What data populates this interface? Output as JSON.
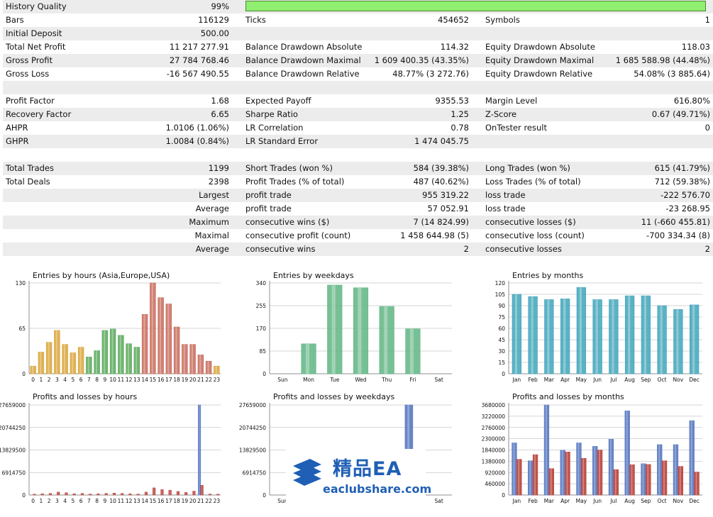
{
  "quality": {
    "label": "History Quality",
    "value": "99%",
    "fraction": 0.99,
    "bar_color": "#90ee70"
  },
  "rows": [
    [
      {
        "l": "Bars",
        "v": "116129"
      },
      {
        "l": "Ticks",
        "v": "454652"
      },
      {
        "l": "Symbols",
        "v": "1"
      }
    ],
    [
      {
        "l": "Initial Deposit",
        "v": "500.00"
      },
      {
        "l": "",
        "v": ""
      },
      {
        "l": "",
        "v": ""
      }
    ],
    [
      {
        "l": "Total Net Profit",
        "v": "11 217 277.91"
      },
      {
        "l": "Balance Drawdown Absolute",
        "v": "114.32"
      },
      {
        "l": "Equity Drawdown Absolute",
        "v": "118.03"
      }
    ],
    [
      {
        "l": "Gross Profit",
        "v": "27 784 768.46"
      },
      {
        "l": "Balance Drawdown Maximal",
        "v": "1 609 400.35 (43.35%)"
      },
      {
        "l": "Equity Drawdown Maximal",
        "v": "1 685 588.98 (44.48%)"
      }
    ],
    [
      {
        "l": "Gross Loss",
        "v": "-16 567 490.55"
      },
      {
        "l": "Balance Drawdown Relative",
        "v": "48.77% (3 272.76)"
      },
      {
        "l": "Equity Drawdown Relative",
        "v": "54.08% (3 885.64)"
      }
    ],
    [
      {
        "l": "",
        "v": ""
      },
      {
        "l": "",
        "v": ""
      },
      {
        "l": "",
        "v": ""
      }
    ],
    [
      {
        "l": "Profit Factor",
        "v": "1.68"
      },
      {
        "l": "Expected Payoff",
        "v": "9355.53"
      },
      {
        "l": "Margin Level",
        "v": "616.80%"
      }
    ],
    [
      {
        "l": "Recovery Factor",
        "v": "6.65"
      },
      {
        "l": "Sharpe Ratio",
        "v": "1.25"
      },
      {
        "l": "Z-Score",
        "v": "0.67 (49.71%)"
      }
    ],
    [
      {
        "l": "AHPR",
        "v": "1.0106 (1.06%)"
      },
      {
        "l": "LR Correlation",
        "v": "0.78"
      },
      {
        "l": "OnTester result",
        "v": "0"
      }
    ],
    [
      {
        "l": "GHPR",
        "v": "1.0084 (0.84%)"
      },
      {
        "l": "LR Standard Error",
        "v": "1 474 045.75"
      },
      {
        "l": "",
        "v": ""
      }
    ],
    [
      {
        "l": "",
        "v": ""
      },
      {
        "l": "",
        "v": ""
      },
      {
        "l": "",
        "v": ""
      }
    ],
    [
      {
        "l": "Total Trades",
        "v": "1199"
      },
      {
        "l": "Short Trades (won %)",
        "v": "584 (39.38%)"
      },
      {
        "l": "Long Trades (won %)",
        "v": "615 (41.79%)"
      }
    ],
    [
      {
        "l": "Total Deals",
        "v": "2398"
      },
      {
        "l": "Profit Trades (% of total)",
        "v": "487 (40.62%)"
      },
      {
        "l": "Loss Trades (% of total)",
        "v": "712 (59.38%)"
      }
    ],
    [
      {
        "r": "Largest"
      },
      {
        "l": "profit trade",
        "v": "955 319.22"
      },
      {
        "l": "loss trade",
        "v": "-222 576.70"
      }
    ],
    [
      {
        "r": "Average"
      },
      {
        "l": "profit trade",
        "v": "57 052.91"
      },
      {
        "l": "loss trade",
        "v": "-23 268.95"
      }
    ],
    [
      {
        "r": "Maximum"
      },
      {
        "l": "consecutive wins ($)",
        "v": "7 (14 824.99)"
      },
      {
        "l": "consecutive losses ($)",
        "v": "11 (-660 455.81)"
      }
    ],
    [
      {
        "r": "Maximal"
      },
      {
        "l": "consecutive profit (count)",
        "v": "1 458 644.98 (5)"
      },
      {
        "l": "consecutive loss (count)",
        "v": "-700 334.34 (8)"
      }
    ],
    [
      {
        "r": "Average"
      },
      {
        "l": "consecutive wins",
        "v": "2"
      },
      {
        "l": "consecutive losses",
        "v": "2"
      }
    ]
  ],
  "chart_data": [
    {
      "type": "bar",
      "title": "Entries by hours (Asia,Europe,USA)",
      "categories": [
        "0",
        "1",
        "2",
        "3",
        "4",
        "5",
        "6",
        "7",
        "8",
        "9",
        "10",
        "11",
        "12",
        "13",
        "14",
        "15",
        "16",
        "17",
        "18",
        "19",
        "20",
        "21",
        "22",
        "23"
      ],
      "values": [
        11,
        31,
        45,
        62,
        42,
        30,
        38,
        24,
        33,
        62,
        64,
        55,
        43,
        38,
        85,
        130,
        109,
        100,
        67,
        42,
        42,
        27,
        18,
        11
      ],
      "yticks": [
        "0",
        "65",
        "130"
      ],
      "ylim": [
        0,
        130
      ],
      "colors": [
        "#d9a53a",
        "#d9a53a",
        "#d9a53a",
        "#d9a53a",
        "#d9a53a",
        "#d9a53a",
        "#d9a53a",
        "#58a85a",
        "#58a85a",
        "#58a85a",
        "#58a85a",
        "#58a85a",
        "#58a85a",
        "#58a85a",
        "#c86a5a",
        "#c86a5a",
        "#c86a5a",
        "#c86a5a",
        "#c86a5a",
        "#c86a5a",
        "#c86a5a",
        "#c86a5a",
        "#c86a5a",
        "#d9a53a"
      ]
    },
    {
      "type": "bar",
      "title": "Entries by weekdays",
      "categories": [
        "Sun",
        "Mon",
        "Tue",
        "Wed",
        "Thu",
        "Fri",
        "Sat"
      ],
      "values": [
        0,
        112,
        332,
        322,
        252,
        168,
        0
      ],
      "yticks": [
        "0",
        "85",
        "170",
        "255",
        "340"
      ],
      "ylim": [
        0,
        340
      ],
      "colors": [
        "#5fb583"
      ]
    },
    {
      "type": "bar",
      "title": "Entries by months",
      "categories": [
        "Jan",
        "Feb",
        "Mar",
        "Apr",
        "May",
        "Jun",
        "Jul",
        "Aug",
        "Sep",
        "Oct",
        "Nov",
        "Dec"
      ],
      "values": [
        105,
        102,
        98,
        99,
        114,
        98,
        98,
        103,
        103,
        90,
        85,
        91
      ],
      "yticks": [
        "0",
        "15",
        "30",
        "45",
        "60",
        "75",
        "90",
        "105",
        "120"
      ],
      "ylim": [
        0,
        120
      ],
      "colors": [
        "#3fa4bb"
      ]
    },
    {
      "type": "bar",
      "title": "Profits and losses by hours",
      "categories": [
        "0",
        "1",
        "2",
        "3",
        "4",
        "5",
        "6",
        "7",
        "8",
        "9",
        "10",
        "11",
        "12",
        "13",
        "14",
        "15",
        "16",
        "17",
        "18",
        "19",
        "20",
        "21",
        "22",
        "23"
      ],
      "series": [
        {
          "color": "#5878c0",
          "values": [
            0,
            0,
            0,
            0,
            0,
            0,
            0,
            0,
            0,
            0,
            0,
            0,
            0,
            0,
            0,
            0,
            0,
            0,
            0,
            0,
            0,
            27659000,
            0,
            0
          ]
        },
        {
          "color": "#b8403a",
          "values": [
            200000,
            400000,
            500000,
            900000,
            700000,
            400000,
            500000,
            300000,
            400000,
            500000,
            600000,
            500000,
            400000,
            300000,
            900000,
            2200000,
            1700000,
            1500000,
            1100000,
            800000,
            1200000,
            3000000,
            300000,
            100000
          ]
        }
      ],
      "yticks": [
        "0",
        "6914750",
        "13829500",
        "20744250",
        "27659000"
      ],
      "ylim": [
        0,
        27659000
      ]
    },
    {
      "type": "bar",
      "title": "Profits and losses by weekdays",
      "categories": [
        "Sun",
        "Mon",
        "Tue",
        "Wed",
        "Thu",
        "Fri",
        "Sat"
      ],
      "series": [
        {
          "color": "#5878c0",
          "values": [
            0,
            0,
            0,
            0,
            0,
            27659000,
            0
          ]
        },
        {
          "color": "#b8403a",
          "values": [
            0,
            0,
            0,
            0,
            0,
            0,
            0
          ]
        }
      ],
      "yticks": [
        "0",
        "6914750",
        "13829500",
        "20744250",
        "27659000"
      ],
      "ylim": [
        0,
        27659000
      ]
    },
    {
      "type": "bar",
      "title": "Profits and losses by months",
      "categories": [
        "Jan",
        "Feb",
        "Mar",
        "Apr",
        "May",
        "Jun",
        "Jul",
        "Aug",
        "Sep",
        "Oct",
        "Nov",
        "Dec"
      ],
      "series": [
        {
          "color": "#5878c0",
          "values": [
            2130000,
            1400000,
            3680000,
            1830000,
            2130000,
            1990000,
            2280000,
            3440000,
            1280000,
            2060000,
            2060000,
            3040000
          ]
        },
        {
          "color": "#b8403a",
          "values": [
            1460000,
            1650000,
            1080000,
            1760000,
            1500000,
            1840000,
            1040000,
            1240000,
            1250000,
            1400000,
            1170000,
            940000
          ]
        }
      ],
      "yticks": [
        "0",
        "460000",
        "920000",
        "1380000",
        "1840000",
        "2300000",
        "2760000",
        "3220000",
        "3680000"
      ],
      "ylim": [
        0,
        3680000
      ]
    }
  ],
  "watermark": {
    "title": "精品EA",
    "url": "eaclubshare.com",
    "color": "#1f5fb5"
  }
}
